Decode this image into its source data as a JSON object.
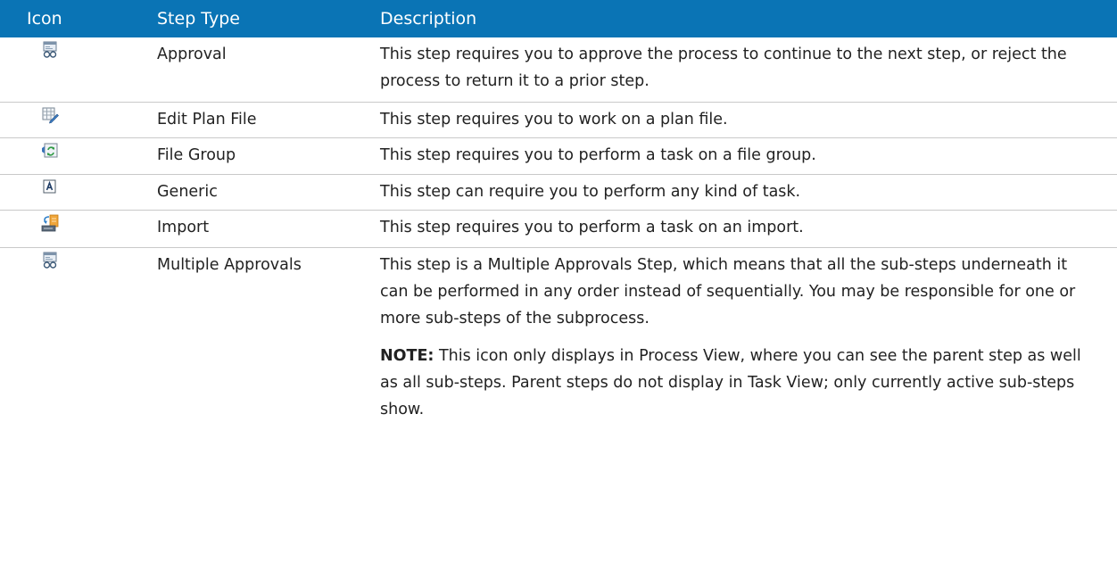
{
  "headers": {
    "icon": "Icon",
    "step_type": "Step Type",
    "description": "Description"
  },
  "rows": [
    {
      "icon": "approval-icon",
      "step_type": "Approval",
      "description": "This step requires you to approve the process to continue to the next step, or reject the process to return it to a prior step."
    },
    {
      "icon": "edit-plan-file-icon",
      "step_type": "Edit Plan File",
      "description": "This step requires you to work on a plan file."
    },
    {
      "icon": "file-group-icon",
      "step_type": "File Group",
      "description": "This step requires you to perform a task on a file group."
    },
    {
      "icon": "generic-icon",
      "step_type": "Generic",
      "description": "This step can require you to perform any kind of task."
    },
    {
      "icon": "import-icon",
      "step_type": "Import",
      "description": "This step requires you to perform a task on an import."
    },
    {
      "icon": "multiple-approvals-icon",
      "step_type": "Multiple Approvals",
      "description": "This step is a Multiple Approvals Step, which means that all the sub-steps underneath it can be performed in any order instead of sequentially. You may be responsible for one or more sub-steps of the subprocess.",
      "note_label": "NOTE:",
      "note_text": " This icon only displays in Process View, where you can see the parent step as well as all sub-steps. Parent steps do not display in Task View; only currently active sub-steps show."
    }
  ],
  "colors": {
    "header_bg": "#0a74b5",
    "header_text": "#ffffff",
    "row_divider": "#c9c9c9"
  }
}
